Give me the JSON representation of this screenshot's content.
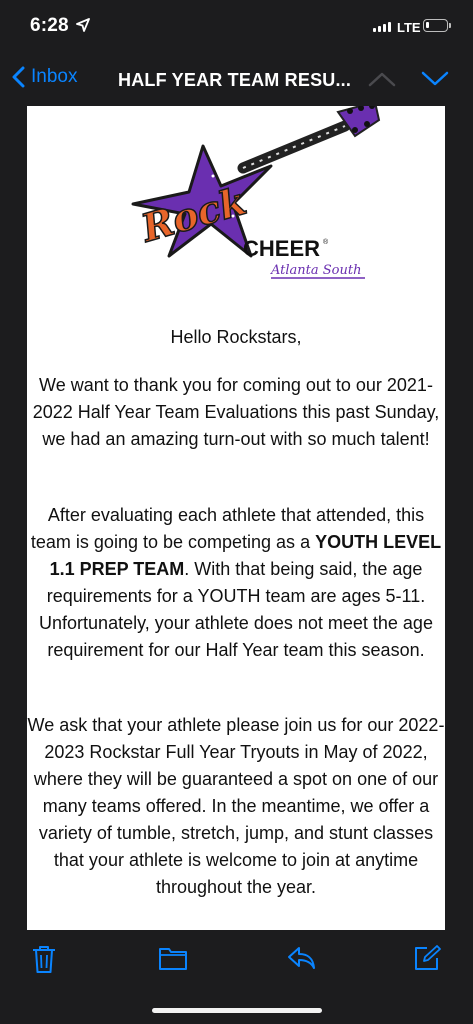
{
  "status_bar": {
    "time": "6:28",
    "network": "LTE",
    "battery_level": 0.18
  },
  "nav": {
    "back_label": "Inbox",
    "title": "HALF YEAR TEAM RESU..."
  },
  "logo": {
    "word_rock": "Rock",
    "word_cheer": "CHEER",
    "location": "Atlanta South"
  },
  "email": {
    "greeting": "Hello Rockstars,",
    "p1": "We want to thank you for coming out to our 2021-2022 Half Year Team Evaluations this past Sunday, we had an amazing turn-out with so much talent!",
    "p2_a": "After evaluating each athlete that attended, this team is going to be competing as a ",
    "p2_bold": "YOUTH LEVEL 1.1 PREP TEAM",
    "p2_b": ". With that being said, the age requirements for a YOUTH team are ages 5-11. Unfortunately, your athlete does not meet the age requirement for our Half Year team this season.",
    "p3": "We ask that your athlete please join us for our 2022-2023 Rockstar Full Year Tryouts in May of 2022, where they will be guaranteed a spot on one of our many teams offered. In the meantime, we offer a variety of tumble, stretch, jump, and stunt classes that your athlete is welcome to join at anytime throughout the year."
  },
  "toolbar": {
    "icons": [
      "trash-icon",
      "folder-icon",
      "reply-icon",
      "compose-icon"
    ]
  },
  "colors": {
    "accent": "#0a84ff",
    "background": "#1c1c1e",
    "logo_purple": "#6a2fb0",
    "logo_orange": "#e8652a"
  }
}
